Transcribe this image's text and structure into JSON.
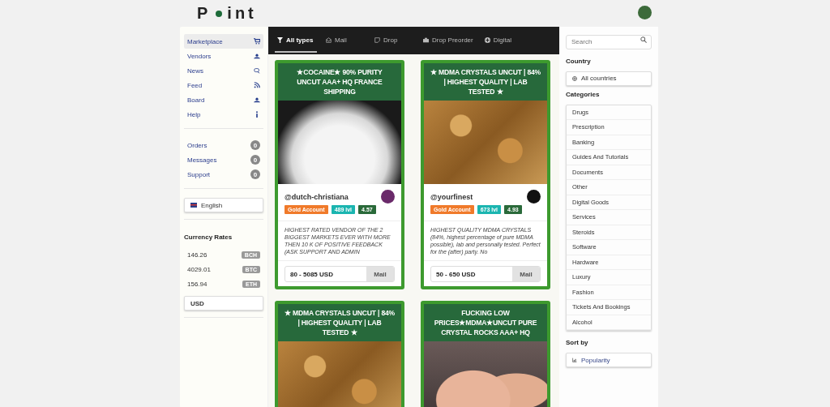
{
  "logo": {
    "before": "P",
    "after": "int"
  },
  "sidebar": {
    "nav": [
      {
        "label": "Marketplace",
        "selected": true
      },
      {
        "label": "Vendors",
        "selected": false
      },
      {
        "label": "News",
        "selected": false
      },
      {
        "label": "Feed",
        "selected": false
      },
      {
        "label": "Board",
        "selected": false
      },
      {
        "label": "Help",
        "selected": false
      }
    ],
    "counters": [
      {
        "label": "Orders",
        "count": "0"
      },
      {
        "label": "Messages",
        "count": "0"
      },
      {
        "label": "Support",
        "count": "0"
      }
    ],
    "language": "English",
    "currency_title": "Currency Rates",
    "rates": [
      {
        "value": "146.26",
        "code": "BCH"
      },
      {
        "value": "4029.01",
        "code": "BTC"
      },
      {
        "value": "156.94",
        "code": "ETH"
      }
    ],
    "currency": "USD"
  },
  "tabs": [
    {
      "label": "All types",
      "selected": true
    },
    {
      "label": "Mail",
      "selected": false
    },
    {
      "label": "Drop",
      "selected": false
    },
    {
      "label": "Drop Preorder",
      "selected": false
    },
    {
      "label": "Digital",
      "selected": false
    }
  ],
  "listings": [
    {
      "title": "★COCAINE★ 90% PURITY UNCUT AAA+ HQ FRANCE SHIPPING",
      "vendor": "@dutch-christiana",
      "account": "Gold Account",
      "level": "489 lvl",
      "rating": "4.57",
      "description": "HIGHEST RATED VENDOR OF THE 2 BIGGEST MARKETS EVER WITH MORE THEN 10 K OF POSITIVE FEEDBACK (ASK SUPPORT AND ADMIN",
      "price": "80 - 5085 USD",
      "shipping": "Mail"
    },
    {
      "title": "★ MDMA CRYSTALS UNCUT | 84% | HIGHEST QUALITY | LAB TESTED ★",
      "vendor": "@yourfinest",
      "account": "Gold Account",
      "level": "673 lvl",
      "rating": "4.93",
      "description": "HIGHEST QUALITY MDMA CRYSTALS (84%, highest percentage of pure MDMA possible), lab and personally tested. Perfect for the (after) party. No",
      "price": "50 - 650 USD",
      "shipping": "Mail"
    },
    {
      "title": "★ MDMA CRYSTALS UNCUT | 84% | HIGHEST QUALITY | LAB TESTED ★"
    },
    {
      "title": "FUCKING LOW PRICES★MDMA★UNCUT PURE CRYSTAL ROCKS AAA+ HQ"
    }
  ],
  "filters": {
    "search_placeholder": "Search",
    "country_title": "Country",
    "country": "All countries",
    "categories_title": "Categories",
    "categories": [
      "Drugs",
      "Prescription",
      "Banking",
      "Guides And Tutorials",
      "Documents",
      "Other",
      "Digital Goods",
      "Services",
      "Steroids",
      "Software",
      "Hardware",
      "Luxury",
      "Fashion",
      "Tickets And Bookings",
      "Alcohol"
    ],
    "sort_title": "Sort by",
    "sort": "Popularity"
  }
}
